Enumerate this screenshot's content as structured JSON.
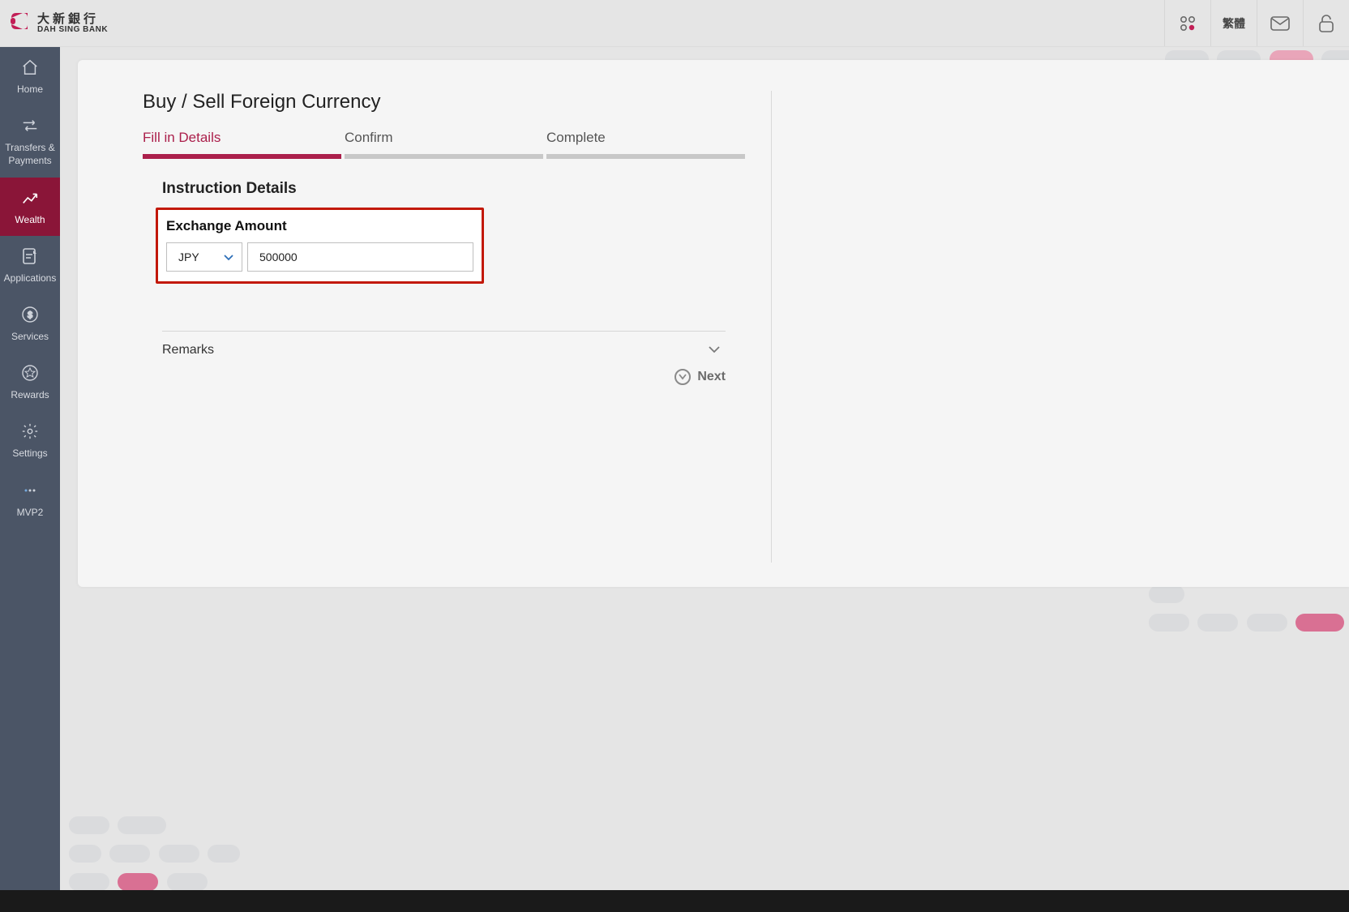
{
  "brand": {
    "zh": "大新銀行",
    "en": "DAH SING BANK"
  },
  "header": {
    "lang": "繁體"
  },
  "sidebar": [
    {
      "id": "home",
      "label": "Home",
      "active": false
    },
    {
      "id": "transfers",
      "label": "Transfers &\nPayments",
      "active": false
    },
    {
      "id": "wealth",
      "label": "Wealth",
      "active": true
    },
    {
      "id": "applications",
      "label": "Applications",
      "active": false
    },
    {
      "id": "services",
      "label": "Services",
      "active": false
    },
    {
      "id": "rewards",
      "label": "Rewards",
      "active": false
    },
    {
      "id": "settings",
      "label": "Settings",
      "active": false
    },
    {
      "id": "mvp2",
      "label": "MVP2",
      "active": false
    }
  ],
  "page": {
    "title": "Buy / Sell Foreign Currency",
    "steps": [
      {
        "label": "Fill in Details",
        "active": true
      },
      {
        "label": "Confirm",
        "active": false
      },
      {
        "label": "Complete",
        "active": false
      }
    ],
    "section_title": "Instruction Details",
    "exchange": {
      "title": "Exchange Amount",
      "currency": "JPY",
      "amount": "500000"
    },
    "remarks_label": "Remarks",
    "next_label": "Next"
  }
}
